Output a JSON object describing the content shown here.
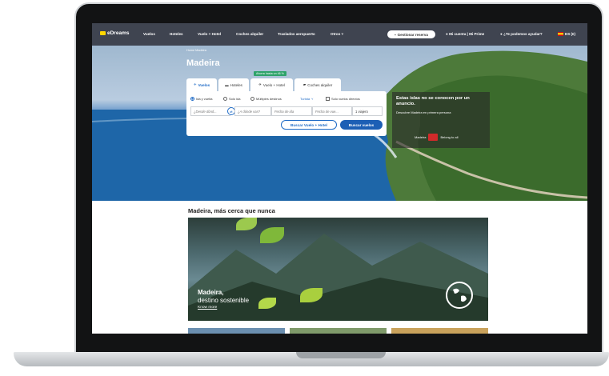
{
  "nav": {
    "logo": "eDreams",
    "items": [
      "Vuelos",
      "Hoteles",
      "Vuelo + Hotel",
      "Coches alquiler",
      "Traslados aeropuerto",
      "Otros"
    ],
    "manage_booking": "Gestionar reserva",
    "account": "Mi cuenta | Mi Prime",
    "help": "¿Te podemos ayudar?",
    "locale": "ES (€)"
  },
  "hero": {
    "breadcrumb": "Home  Madeira",
    "title": "Madeira",
    "savings_badge": "Ahorra hasta un 46 %",
    "tabs": [
      "Vuelos",
      "Hoteles",
      "Vuelo + Hotel",
      "Coches alquiler"
    ],
    "trip_types": [
      "Ida y vuelta",
      "Solo ida",
      "Múltiples destinos"
    ],
    "cabin_class": "Turista",
    "direct_only": "Solo vuelos directos",
    "origin_placeholder": "¿Desde dónd...",
    "destination_placeholder": "¿A dónde vas?",
    "depart_placeholder": "Fecha de ida",
    "return_placeholder": "Fecha de vue...",
    "travellers": "1 viajero",
    "search_package_button": "Buscar Vuelo + Hotel",
    "search_flights_button": "Buscar vuelos"
  },
  "ad": {
    "title": "Estas islas no se conocen por un anuncio.",
    "subtitle": "Descubre Madeira en primera persona",
    "brand": "Madeira",
    "tagline": "Belong to all"
  },
  "content": {
    "section_title": "Madeira, más cerca que nunca",
    "card_title": "Madeira,",
    "card_subtitle": "destino sostenible",
    "card_link": "Know more"
  },
  "colors": {
    "nav_bg": "#3f4450",
    "accent": "#1d6ac6",
    "badge": "#2ea36a",
    "logo_yellow": "#ffd600"
  }
}
